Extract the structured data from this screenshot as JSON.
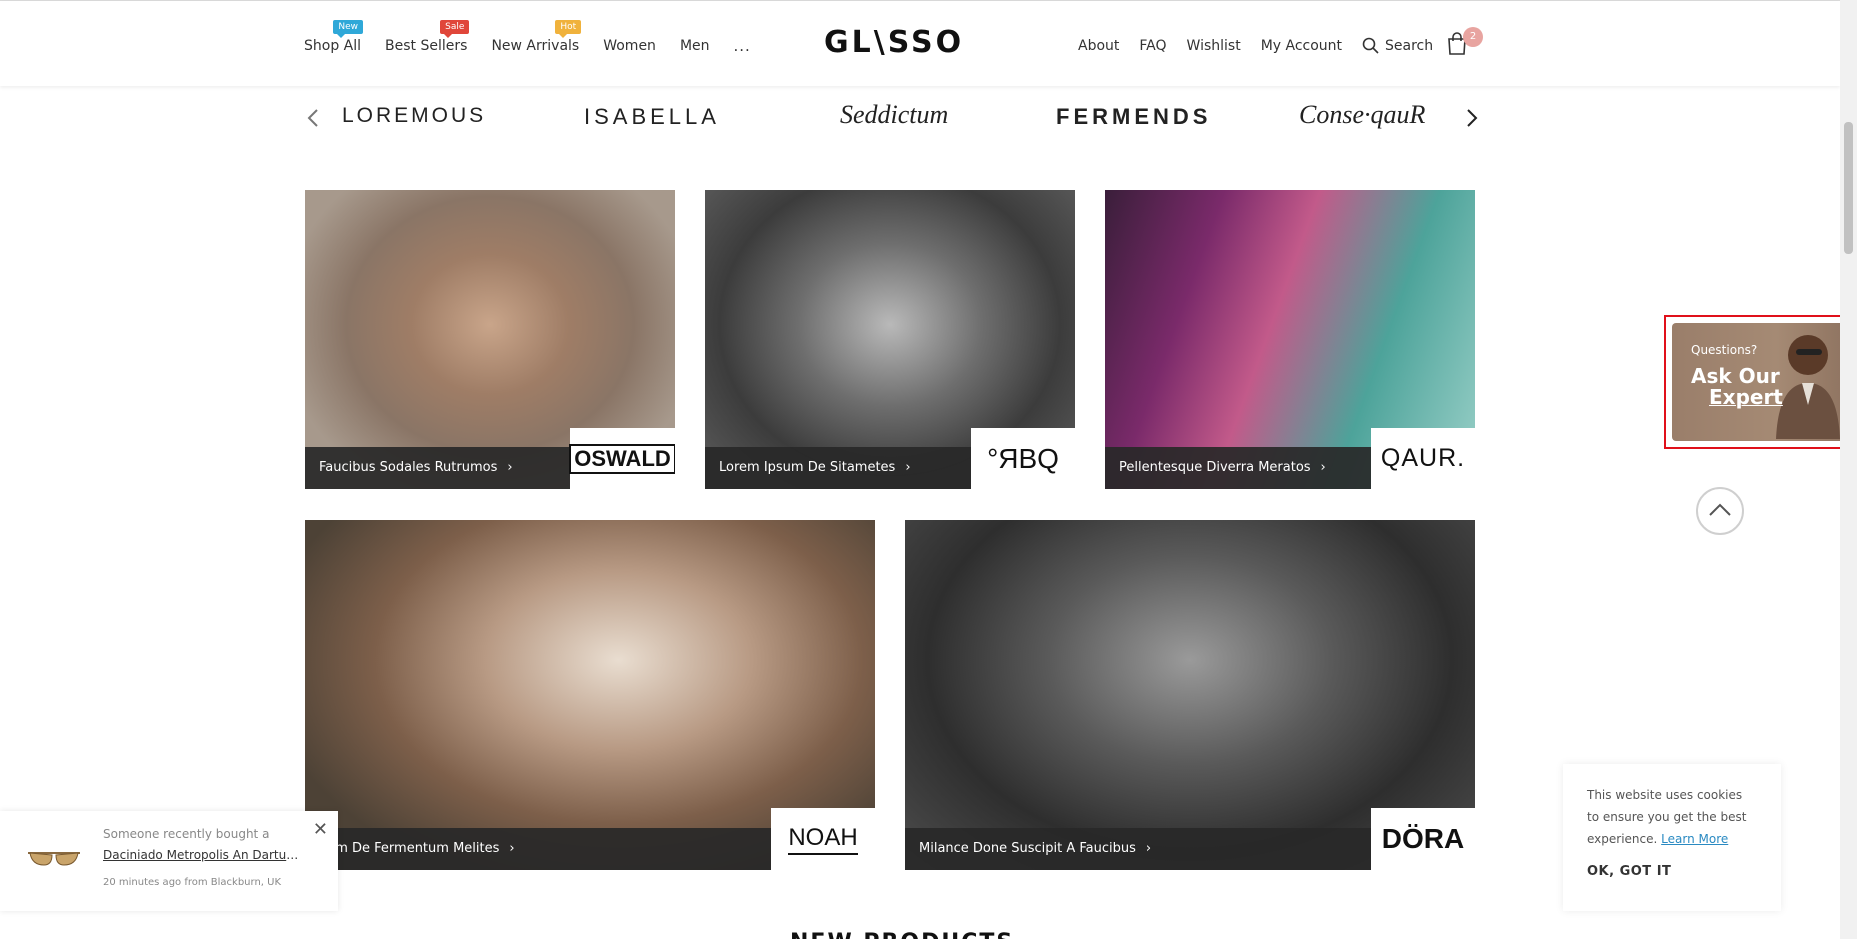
{
  "header": {
    "logo": "GL\\SSO",
    "nav_left": [
      {
        "label": "Shop All",
        "badge": "New",
        "badge_color": "#2fa8d8"
      },
      {
        "label": "Best Sellers",
        "badge": "Sale",
        "badge_color": "#e0463a"
      },
      {
        "label": "New Arrivals",
        "badge": "Hot",
        "badge_color": "#f0b23c"
      },
      {
        "label": "Women",
        "badge": "",
        "badge_color": ""
      },
      {
        "label": "Men",
        "badge": "",
        "badge_color": ""
      },
      {
        "label": "...",
        "badge": "",
        "badge_color": ""
      }
    ],
    "nav_right": [
      "About",
      "FAQ",
      "Wishlist",
      "My Account"
    ],
    "search_label": "Search",
    "cart_count": "2"
  },
  "brands": [
    "LOREMOUS",
    "ISABELLA",
    "Seddictum",
    "FERMENDS",
    "Conse·qauR"
  ],
  "tiles": [
    {
      "caption": "Faucibus Sodales Rutrumos",
      "logo": "OSWALD"
    },
    {
      "caption": "Lorem Ipsum De Sitametes",
      "logo": "°ЯBQ"
    },
    {
      "caption": "Pellentesque Diverra Meratos",
      "logo": "QAUR."
    },
    {
      "caption": "dam De Fermentum Melites",
      "logo": "NOAH"
    },
    {
      "caption": "Milance Done Suscipit A Faucibus",
      "logo": "DÖRA"
    }
  ],
  "expert": {
    "question": "Questions?",
    "title_line1": "Ask Our",
    "title_line2": "Expert"
  },
  "cookie": {
    "text": "This website uses cookies to ensure you get the best experience.",
    "link": "Learn More",
    "button": "OK, GOT IT"
  },
  "purchase": {
    "line1": "Someone recently bought a",
    "product": "Daciniado Metropolis An Darturi...",
    "time": "20 minutes ago from Blackburn, UK"
  },
  "section_title": "NEW PRODUCTS",
  "colors": {
    "accent": "#e8a4a0",
    "caption_bg": "#282828",
    "highlight_border": "#e0101a",
    "link": "#2a8ac2"
  }
}
